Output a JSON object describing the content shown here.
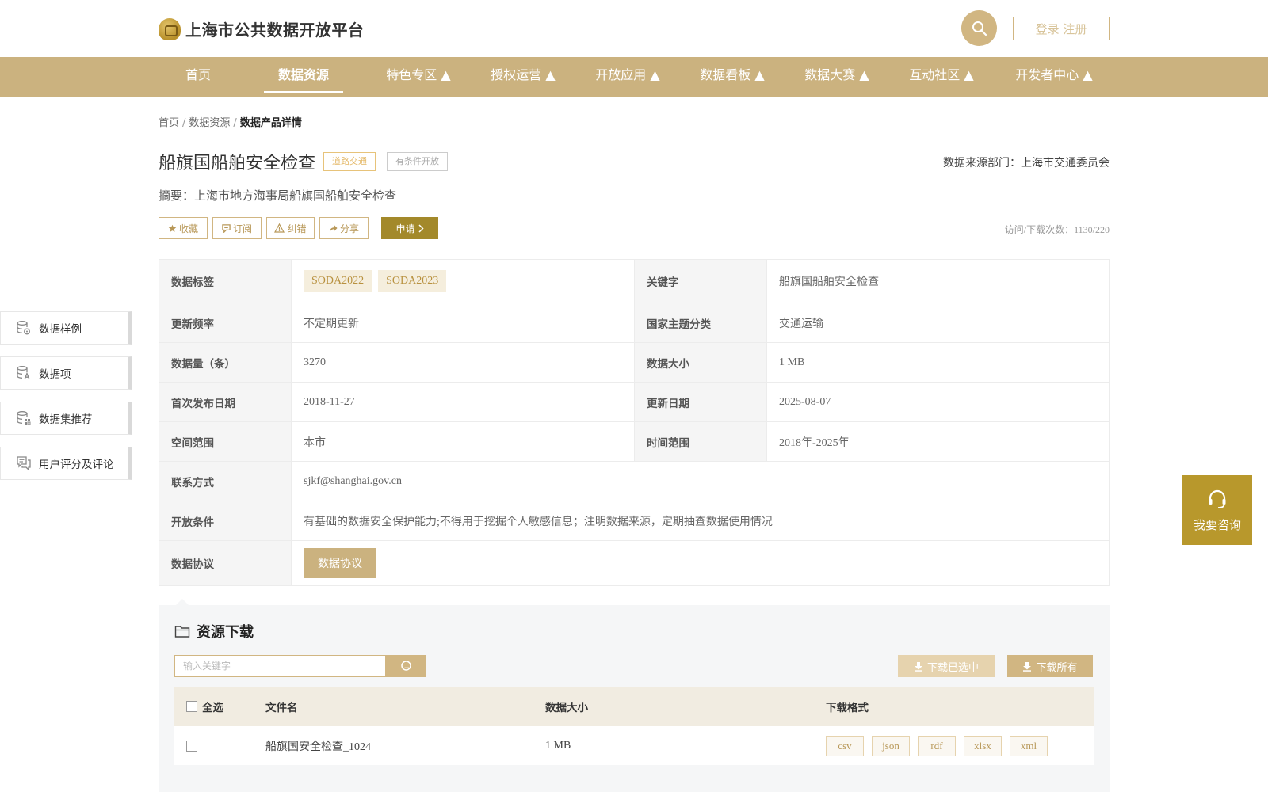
{
  "header": {
    "site_title": "上海市公共数据开放平台",
    "login_label": "登录 注册"
  },
  "nav": {
    "items": [
      {
        "label": "首页"
      },
      {
        "label": "数据资源"
      },
      {
        "label": "特色专区 ▲"
      },
      {
        "label": "授权运营 ▲"
      },
      {
        "label": "开放应用 ▲"
      },
      {
        "label": "数据看板 ▲"
      },
      {
        "label": "数据大赛 ▲"
      },
      {
        "label": "互动社区 ▲"
      },
      {
        "label": "开发者中心 ▲"
      }
    ],
    "active_index": 1
  },
  "breadcrumb": {
    "home": "首页",
    "sep": "/",
    "section": "数据资源",
    "current": "数据产品详情"
  },
  "dataset": {
    "title": "船旗国船舶安全检查",
    "category_tag": "道路交通",
    "open_tag": "有条件开放",
    "source_dept": "数据来源部门：上海市交通委员会",
    "summary": "摘要：上海市地方海事局船旗国船舶安全检查",
    "visits": "访问/下载次数：1130/220"
  },
  "actions": {
    "favorite": "收藏",
    "subscribe": "订阅",
    "report": "纠错",
    "share": "分享",
    "apply": "申请"
  },
  "info": {
    "tags_label": "数据标签",
    "tags": [
      "SODA2022",
      "SODA2023"
    ],
    "keyword_label": "关键字",
    "keyword": "船旗国船舶安全检查",
    "freq_label": "更新频率",
    "freq": "不定期更新",
    "theme_label": "国家主题分类",
    "theme": "交通运输",
    "count_label": "数据量（条）",
    "count": "3270",
    "size_label": "数据大小",
    "size": "1 MB",
    "first_pub_label": "首次发布日期",
    "first_pub": "2018-11-27",
    "update_label": "更新日期",
    "update": "2025-08-07",
    "space_label": "空间范围",
    "space": "本市",
    "time_label": "时间范围",
    "time": "2018年-2025年",
    "contact_label": "联系方式",
    "contact": "sjkf@shanghai.gov.cn",
    "cond_label": "开放条件",
    "cond": "有基础的数据安全保护能力;不得用于挖掘个人敏感信息；注明数据来源，定期抽查数据使用情况",
    "protocol_label": "数据协议",
    "protocol_btn": "数据协议"
  },
  "side_menu": {
    "items": [
      {
        "label": "数据样例",
        "icon": "database-sample-icon"
      },
      {
        "label": "数据项",
        "icon": "database-field-icon"
      },
      {
        "label": "数据集推荐",
        "icon": "database-recommend-icon"
      },
      {
        "label": "用户评分及评论",
        "icon": "comment-icon"
      }
    ]
  },
  "consult": {
    "label": "我要咨询",
    "icon": "headset-icon"
  },
  "resources": {
    "title": "资源下载",
    "search_placeholder": "输入关键字",
    "download_selected": "下载已选中",
    "download_all": "下载所有",
    "columns": {
      "select_all": "全选",
      "file_name": "文件名",
      "size": "数据大小",
      "format": "下载格式"
    },
    "rows": [
      {
        "file_name": "船旗国安全检查_1024",
        "size": "1 MB",
        "formats": [
          "csv",
          "json",
          "rdf",
          "xlsx",
          "xml"
        ]
      }
    ]
  },
  "colors": {
    "brand": "#cbb27f",
    "apply": "#a3892a",
    "consult": "#b8982c"
  }
}
